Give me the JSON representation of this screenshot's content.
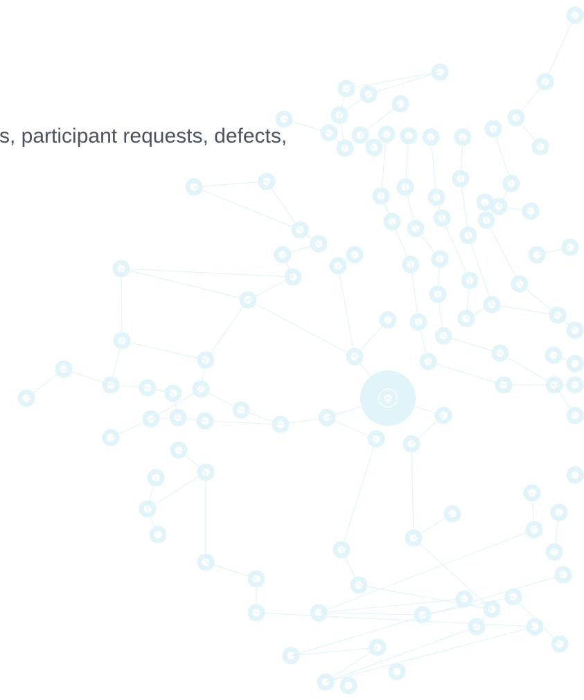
{
  "content": {
    "text_line": "s, participant requests, defects,"
  },
  "background": {
    "decoration": "network-graph-illustration",
    "node_color": "#e0f4f9",
    "text_color": "#4b5360"
  }
}
